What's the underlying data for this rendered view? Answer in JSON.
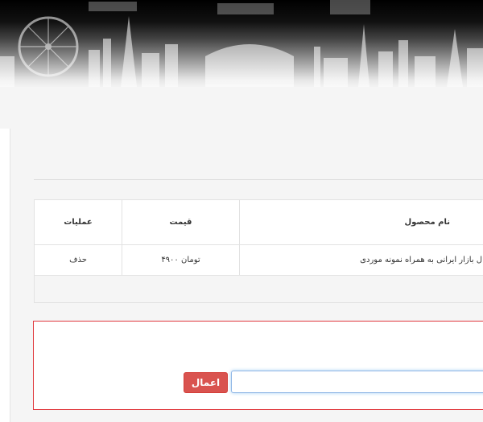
{
  "banner": {
    "image": "city-skyline-silhouette"
  },
  "cart": {
    "columns": {
      "operations": "عملیات",
      "price": "قیمت",
      "product_name": "نام محصول"
    },
    "rows": [
      {
        "operation": "حذف",
        "price": "۴۹۰۰ تومان",
        "product_name": "ل بازار ایرانی به همراه نمونه موردی"
      }
    ]
  },
  "discount": {
    "apply_label": "اعمال",
    "code_value": "",
    "code_placeholder": ""
  },
  "colors": {
    "accent_red": "#d9534f",
    "box_border": "#e0393e",
    "input_focus": "#66afe9"
  }
}
